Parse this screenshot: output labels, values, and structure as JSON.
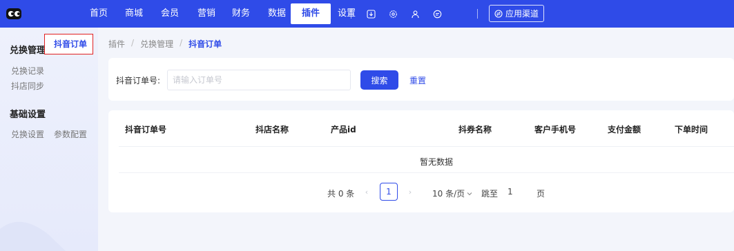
{
  "topnav": {
    "items": [
      {
        "label": "首页"
      },
      {
        "label": "商城"
      },
      {
        "label": "会员"
      },
      {
        "label": "营销"
      },
      {
        "label": "财务"
      },
      {
        "label": "数据"
      },
      {
        "label": "插件",
        "active": true
      },
      {
        "label": "设置"
      }
    ],
    "toolbar_icons": [
      "download-icon",
      "settings-icon",
      "user-icon",
      "message-icon"
    ],
    "channel_button": "应用渠道"
  },
  "sidebar": {
    "sections": [
      {
        "title": "兑换管理",
        "links": [
          "兑换记录",
          "抖音订单",
          "抖店同步"
        ]
      },
      {
        "title": "基础设置",
        "links": [
          "兑换设置",
          "参数配置"
        ]
      }
    ],
    "active": "抖音订单"
  },
  "breadcrumb": [
    "插件",
    "兑换管理",
    "抖音订单"
  ],
  "filter": {
    "label": "抖音订单号:",
    "placeholder": "请输入订单号",
    "search_label": "搜索",
    "reset_label": "重置"
  },
  "table": {
    "columns": [
      "抖音订单号",
      "抖店名称",
      "产品id",
      "抖券名称",
      "客户手机号",
      "支付金额",
      "下单时间"
    ],
    "rows": [],
    "empty_text": "暂无数据"
  },
  "pagination": {
    "total_text": "共 0 条",
    "current_page": "1",
    "page_size": "10 条/页",
    "jump_label": "跳至",
    "jump_value": "1",
    "page_unit": "页"
  },
  "colors": {
    "primary": "#2f4be8",
    "highlight_border": "#e02020",
    "background": "#f3f5fb"
  }
}
